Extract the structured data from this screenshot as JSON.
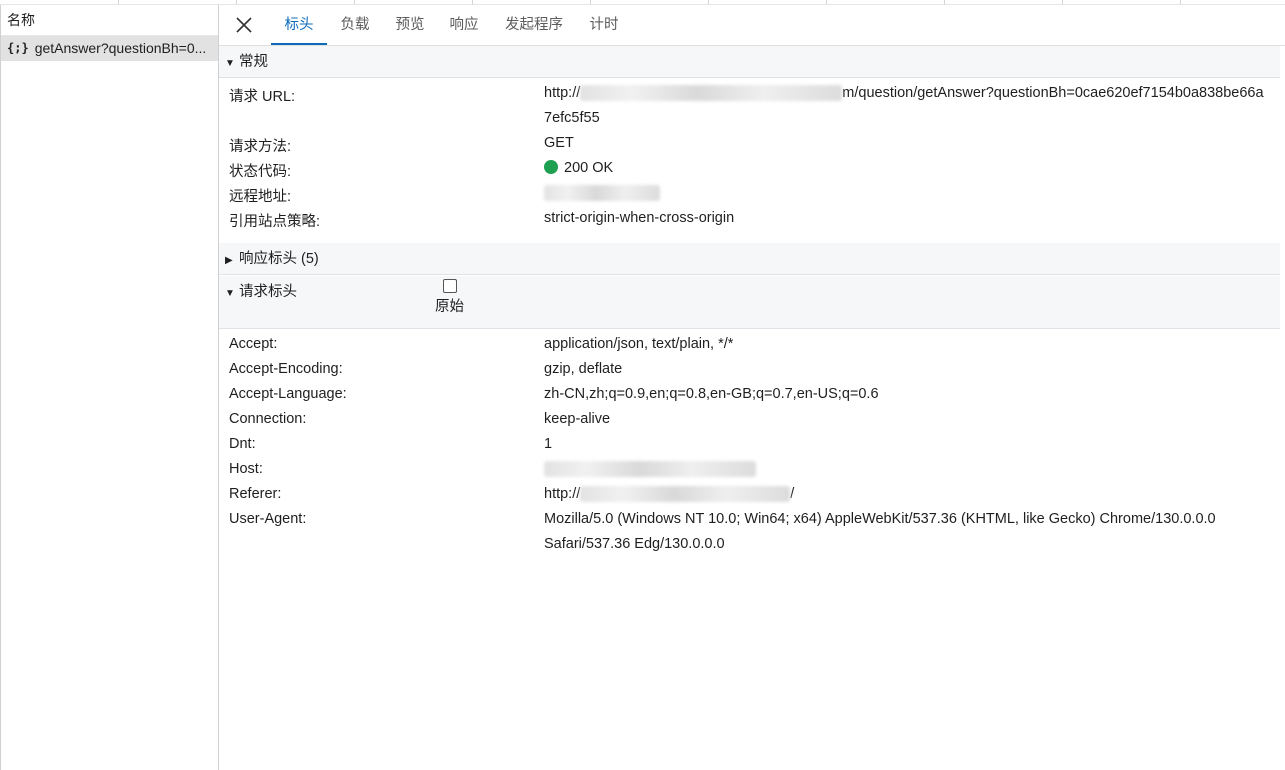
{
  "left": {
    "header": "名称",
    "rows": [
      {
        "icon": "{;}",
        "label": "getAnswer?questionBh=0..."
      }
    ]
  },
  "tabs": [
    {
      "label": "标头",
      "active": true
    },
    {
      "label": "负载"
    },
    {
      "label": "预览"
    },
    {
      "label": "响应"
    },
    {
      "label": "发起程序"
    },
    {
      "label": "计时"
    }
  ],
  "general": {
    "title": "常规",
    "expanded": true,
    "url_label": "请求 URL:",
    "url_value_prefix": "http://",
    "url_value_suffix": "m/question/getAnswer?questionBh=0cae620ef7154b0a838be66a",
    "url_value_line2": "7efc5f55",
    "method_label": "请求方法:",
    "method_value": "GET",
    "status_label": "状态代码:",
    "status_value": "200 OK",
    "status_color": "#1fa050",
    "remote_label": "远程地址:",
    "referrer_policy_label": "引用站点策略:",
    "referrer_policy_value": "strict-origin-when-cross-origin"
  },
  "response_headers": {
    "title": "响应标头 (5)",
    "expanded": false
  },
  "request_headers": {
    "title": "请求标头",
    "expanded": true,
    "raw_label": "原始",
    "raw_checked": false,
    "accept_label": "Accept:",
    "accept_value": "application/json, text/plain, */*",
    "encoding_label": "Accept-Encoding:",
    "encoding_value": "gzip, deflate",
    "language_label": "Accept-Language:",
    "language_value": "zh-CN,zh;q=0.9,en;q=0.8,en-GB;q=0.7,en-US;q=0.6",
    "connection_label": "Connection:",
    "connection_value": "keep-alive",
    "dnt_label": "Dnt:",
    "dnt_value": "1",
    "host_label": "Host:",
    "referer_label": "Referer:",
    "referer_value_prefix": "http://",
    "referer_value_suffix": "/",
    "ua_label": "User-Agent:",
    "ua_value_line1": "Mozilla/5.0 (Windows NT 10.0; Win64; x64) AppleWebKit/537.36 (KHTML, like Gecko) Chrome/130.0.0.0",
    "ua_value_line2": "Safari/537.36 Edg/130.0.0.0"
  },
  "colors": {
    "accent": "#0f6cbd",
    "selected_row": "#e2e2e2",
    "section_bg": "#f6f7f9"
  }
}
